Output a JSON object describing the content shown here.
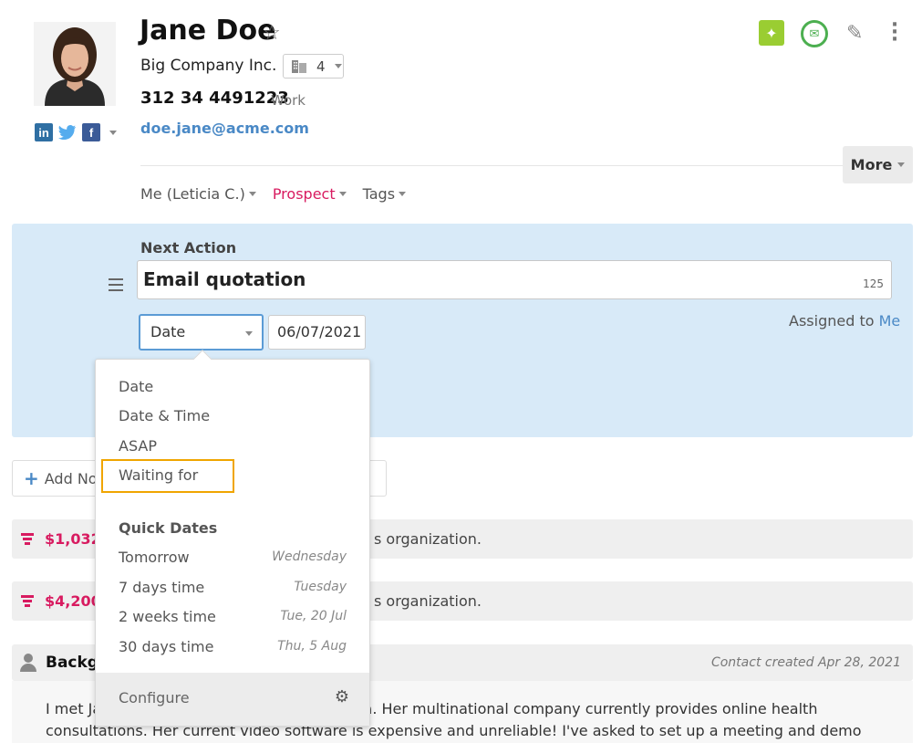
{
  "contact": {
    "name": "Jane Doe",
    "company": "Big Company Inc.",
    "company_count": "4",
    "phone": "312 34 4491223",
    "phone_type": "Work",
    "email": "doe.jane@acme.com"
  },
  "social": [
    "linkedin-icon",
    "twitter-icon",
    "facebook-icon"
  ],
  "header_actions": {
    "more_label": "More"
  },
  "meta": {
    "owner": "Me (Leticia C.)",
    "status": "Prospect",
    "tags": "Tags"
  },
  "next_action": {
    "title": "Next Action",
    "value": "Email quotation",
    "char_count": "125",
    "assigned_label": "Assigned to",
    "assigned_to": "Me",
    "date_type": "Date",
    "date_value": "06/07/2021"
  },
  "dropdown": {
    "options": [
      "Date",
      "Date & Time",
      "ASAP",
      "Waiting for"
    ],
    "quick_dates_title": "Quick Dates",
    "quick_dates": [
      {
        "label": "Tomorrow",
        "day": "Wednesday"
      },
      {
        "label": "7 days time",
        "day": "Tuesday"
      },
      {
        "label": "2 weeks time",
        "day": "Tue, 20 Jul"
      },
      {
        "label": "30 days time",
        "day": "Thu, 5 Aug"
      }
    ],
    "configure": "Configure"
  },
  "add_note_label": "Add Not",
  "deals": [
    {
      "amount": "$1,032",
      "text": "s organization."
    },
    {
      "amount": "$4,200",
      "text": "s organization."
    }
  ],
  "background": {
    "title": "Backgr",
    "created": "Contact created Apr 28, 2021",
    "line1a": "I met Ja",
    "line1b": "lorida. Her multinational company currently provides online health",
    "line2": "consultations. Her current video software is expensive and unreliable! I've asked to set up a meeting and demo of our"
  }
}
